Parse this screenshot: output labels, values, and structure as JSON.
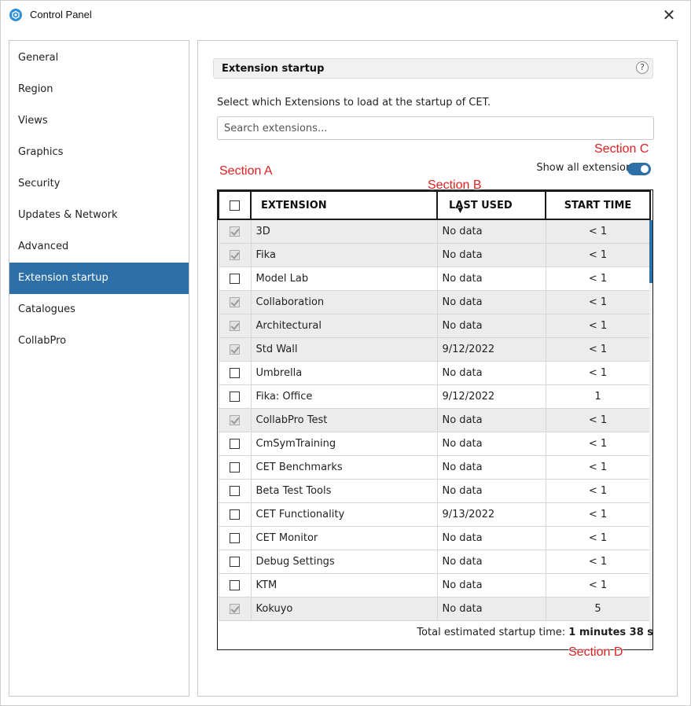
{
  "window": {
    "title": "Control Panel"
  },
  "sidebar": {
    "items": [
      {
        "label": "General"
      },
      {
        "label": "Region"
      },
      {
        "label": "Views"
      },
      {
        "label": "Graphics"
      },
      {
        "label": "Security"
      },
      {
        "label": "Updates & Network"
      },
      {
        "label": "Advanced"
      },
      {
        "label": "Extension startup"
      },
      {
        "label": "Catalogues"
      },
      {
        "label": "CollabPro"
      }
    ],
    "active_index": 7
  },
  "content": {
    "section_title": "Extension startup",
    "help_label": "?",
    "description": "Select which Extensions to load at the startup of CET.",
    "search_placeholder": "Search extensions...",
    "show_all_label": "Show all extensions",
    "show_all_on": true,
    "table": {
      "headers": {
        "extension": "EXTENSION",
        "last_used": "LAST USED",
        "start_time": "START TIME"
      },
      "rows": [
        {
          "checked": true,
          "name": "3D",
          "last": "No data",
          "start": "< 1"
        },
        {
          "checked": true,
          "name": "Fika",
          "last": "No data",
          "start": "< 1"
        },
        {
          "checked": false,
          "name": "Model Lab",
          "last": "No data",
          "start": "< 1"
        },
        {
          "checked": true,
          "name": "Collaboration",
          "last": "No data",
          "start": "< 1"
        },
        {
          "checked": true,
          "name": "Architectural",
          "last": "No data",
          "start": "< 1"
        },
        {
          "checked": true,
          "name": "Std Wall",
          "last": "9/12/2022",
          "start": "< 1"
        },
        {
          "checked": false,
          "name": "Umbrella",
          "last": "No data",
          "start": "< 1"
        },
        {
          "checked": false,
          "name": "Fika: Office",
          "last": "9/12/2022",
          "start": "1"
        },
        {
          "checked": true,
          "name": "CollabPro Test",
          "last": "No data",
          "start": "< 1"
        },
        {
          "checked": false,
          "name": "CmSymTraining",
          "last": "No data",
          "start": "< 1"
        },
        {
          "checked": false,
          "name": "CET Benchmarks",
          "last": "No data",
          "start": "< 1"
        },
        {
          "checked": false,
          "name": "Beta Test Tools",
          "last": "No data",
          "start": "< 1"
        },
        {
          "checked": false,
          "name": "CET Functionality",
          "last": "9/13/2022",
          "start": "< 1"
        },
        {
          "checked": false,
          "name": "CET Monitor",
          "last": "No data",
          "start": "< 1"
        },
        {
          "checked": false,
          "name": "Debug Settings",
          "last": "No data",
          "start": "< 1"
        },
        {
          "checked": false,
          "name": "KTM",
          "last": "No data",
          "start": "< 1"
        },
        {
          "checked": true,
          "name": "Kokuyo",
          "last": "No data",
          "start": "5"
        }
      ]
    },
    "total_label": "Total estimated startup time:",
    "total_value": "1 minutes 38 s"
  },
  "annotations": {
    "a": "Section A",
    "b": "Section B",
    "c": "Section C",
    "d": "Section D"
  },
  "colors": {
    "accent": "#2d6fa7",
    "annotation": "#e02020"
  }
}
